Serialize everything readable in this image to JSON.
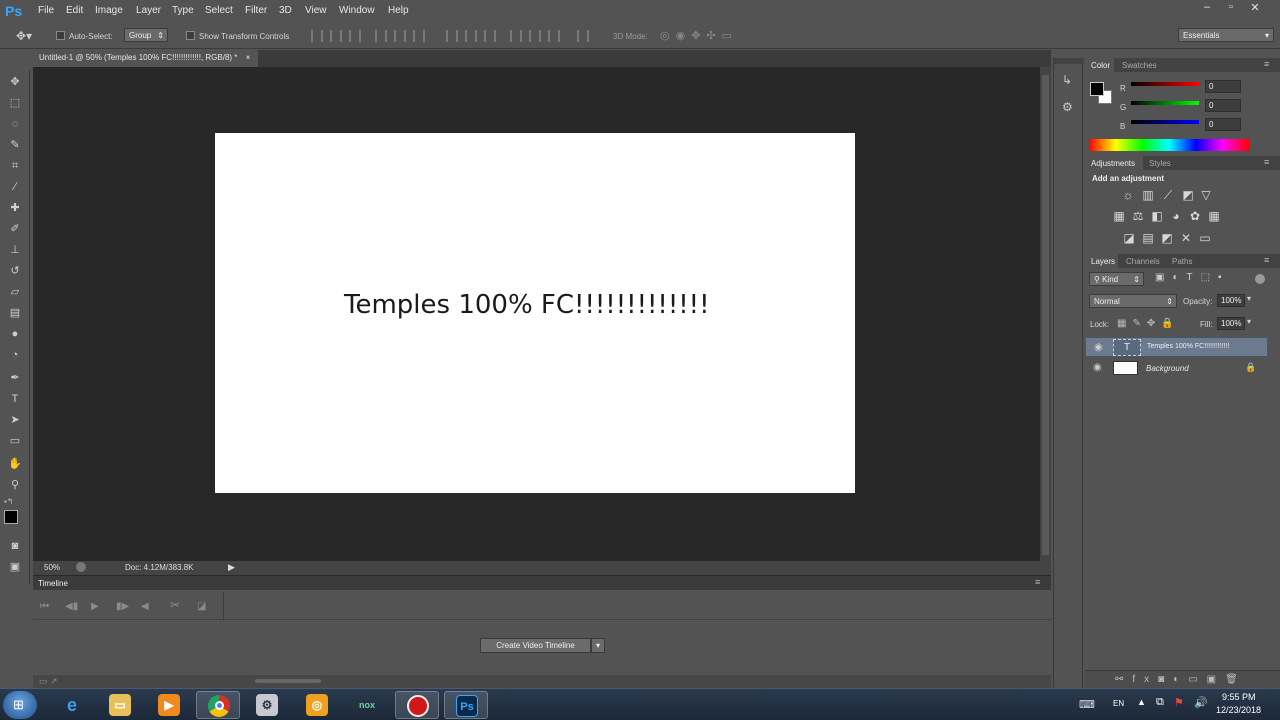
{
  "app": {
    "logo": "Ps"
  },
  "menu": [
    "File",
    "Edit",
    "Image",
    "Layer",
    "Type",
    "Select",
    "Filter",
    "3D",
    "View",
    "Window",
    "Help"
  ],
  "window_controls": [
    "–",
    "▫",
    "✕"
  ],
  "options_bar": {
    "auto_select_label": "Auto-Select:",
    "auto_select_value": "Group",
    "show_transform_label": "Show Transform Controls",
    "mode_3d_label": "3D Mode:",
    "workspace": "Essentials"
  },
  "document": {
    "tab_title": "Untitled-1 @ 50% (Temples 100% FC!!!!!!!!!!!!!, RGB/8) *",
    "tab_close": "×",
    "canvas_text": "Temples 100% FC!!!!!!!!!!!!!",
    "zoom": "50%",
    "doc_size": "Doc: 4.12M/383.8K"
  },
  "timeline": {
    "title": "Timeline",
    "create_button": "Create Video Timeline"
  },
  "color_panel": {
    "tabs": [
      "Color",
      "Swatches"
    ],
    "r_label": "R",
    "g_label": "G",
    "b_label": "B",
    "r": "0",
    "g": "0",
    "b": "0"
  },
  "adjustments_panel": {
    "tabs": [
      "Adjustments",
      "Styles"
    ],
    "heading": "Add an adjustment"
  },
  "layers_panel": {
    "tabs": [
      "Layers",
      "Channels",
      "Paths"
    ],
    "kind_filter": "Kind",
    "blend_mode": "Normal",
    "opacity_label": "Opacity:",
    "opacity": "100%",
    "lock_label": "Lock:",
    "fill_label": "Fill:",
    "fill": "100%",
    "layers": [
      {
        "name": "Temples 100% FC!!!!!!!!!!!!!",
        "thumb": "T"
      },
      {
        "name": "Background"
      }
    ]
  },
  "taskbar": {
    "language": "EN",
    "time": "9:55 PM",
    "date": "12/23/2018",
    "nox_label": "nox",
    "ps_label": "Ps"
  },
  "colors": {
    "accent": "#31a8ff",
    "canvas_bg": "#282828",
    "ui_bg": "#535353",
    "chrome_red": "#d93025",
    "chrome_yellow": "#f4c20d",
    "chrome_green": "#1ea362"
  }
}
